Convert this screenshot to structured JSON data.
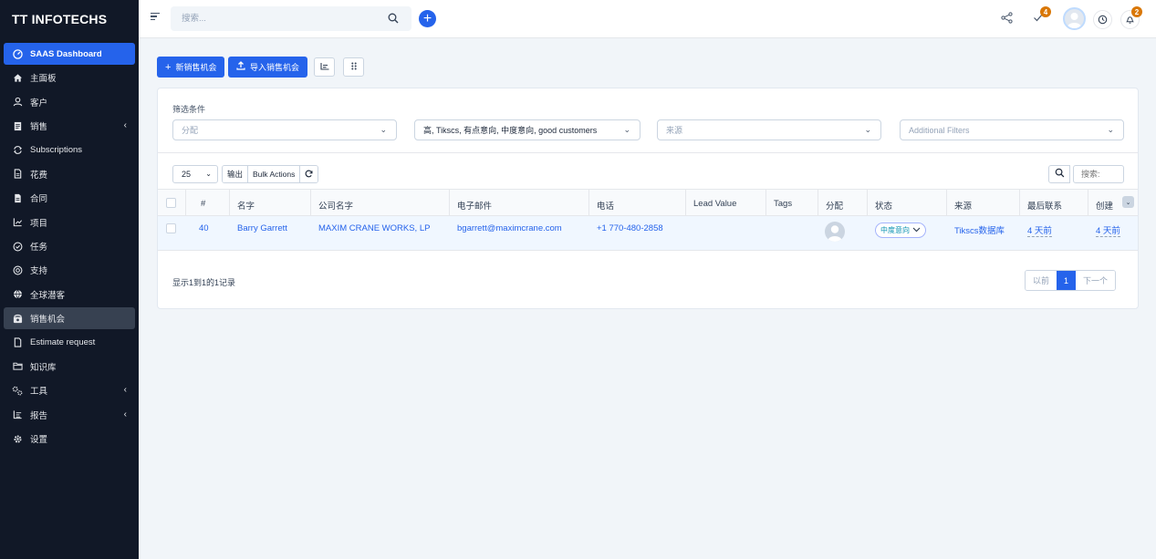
{
  "brand": "TT INFOTECHS",
  "topbar": {
    "search_placeholder": "搜索...",
    "tasks_badge": "4",
    "notifications_badge": "2"
  },
  "sidebar": {
    "items": [
      {
        "label": "SAAS Dashboard",
        "icon": "dashboard-icon"
      },
      {
        "label": "主面板",
        "icon": "home-icon"
      },
      {
        "label": "客户",
        "icon": "user-icon"
      },
      {
        "label": "销售",
        "icon": "receipt-icon"
      },
      {
        "label": "Subscriptions",
        "icon": "repeat-icon"
      },
      {
        "label": "花费",
        "icon": "file-icon"
      },
      {
        "label": "合同",
        "icon": "contract-icon"
      },
      {
        "label": "项目",
        "icon": "chart-icon"
      },
      {
        "label": "任务",
        "icon": "check-circle-icon"
      },
      {
        "label": "支持",
        "icon": "support-icon"
      },
      {
        "label": "全球潜客",
        "icon": "globe-icon"
      },
      {
        "label": "销售机会",
        "icon": "phone-icon"
      },
      {
        "label": "Estimate request",
        "icon": "document-icon"
      },
      {
        "label": "知识库",
        "icon": "folder-icon"
      },
      {
        "label": "工具",
        "icon": "cogs-icon"
      },
      {
        "label": "报告",
        "icon": "report-icon"
      },
      {
        "label": "设置",
        "icon": "gear-icon"
      }
    ]
  },
  "actions": {
    "new_label": "新销售机会",
    "import_label": "导入销售机会"
  },
  "filters": {
    "title": "筛选条件",
    "assign_placeholder": "分配",
    "status_value": "高, Tikscs, 有点意向, 中度意向, good customers",
    "source_placeholder": "来源",
    "additional_placeholder": "Additional Filters"
  },
  "table_tools": {
    "page_length": "25",
    "export_label": "输出",
    "bulk_label": "Bulk Actions",
    "search_placeholder": "搜索:"
  },
  "table": {
    "columns": [
      "#",
      "名字",
      "公司名字",
      "电子邮件",
      "电话",
      "Lead Value",
      "Tags",
      "分配",
      "状态",
      "来源",
      "最后联系",
      "创建"
    ],
    "rows": [
      {
        "id": "40",
        "name": "Barry Garrett",
        "company": "MAXIM CRANE WORKS, LP",
        "email": "bgarrett@maximcrane.com",
        "phone": "+1 770-480-2858",
        "lead_value": "",
        "tags": "",
        "status": "中度意向",
        "source": "Tikscs数据库",
        "last_contact": "4 天前",
        "created": "4 天前"
      }
    ]
  },
  "pagination": {
    "info": "显示1到1的1记录",
    "prev": "以前",
    "current": "1",
    "next": "下一个"
  },
  "colors": {
    "accent": "#2563eb",
    "sidebar_bg": "#111827",
    "badge": "#d97706"
  }
}
